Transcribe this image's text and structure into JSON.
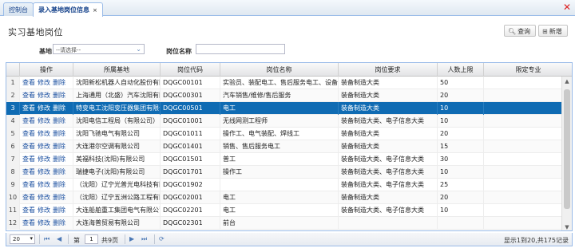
{
  "tabs": [
    {
      "label": "控制台"
    },
    {
      "label": "录入基地岗位信息",
      "close": "×"
    }
  ],
  "window_close_icon": "close-icon",
  "page": {
    "title": "实习基地岗位"
  },
  "toolbar": {
    "search_label": "查询",
    "add_label": "新增"
  },
  "filters": {
    "base_label": "基地",
    "base_value": "--请选择--",
    "post_label": "岗位名称",
    "post_value": ""
  },
  "grid": {
    "columns": [
      "",
      "操作",
      "所属基地",
      "岗位代码",
      "岗位名称",
      "岗位要求",
      "人数上限",
      "限定专业"
    ],
    "ops": {
      "view": "查看",
      "edit": "修改",
      "delete": "删除"
    },
    "rows": [
      {
        "no": "1",
        "base": "沈阳新松机器人自动化股份有限公",
        "code": "DQGC00101",
        "name": "实验员、装配电工、售后服务电工、设备调试",
        "req": "装备制造大类",
        "limit": "50",
        "major": ""
      },
      {
        "no": "2",
        "base": "上海通用（北盛）汽车沈阳有限公",
        "code": "DQGC00301",
        "name": "汽车销售/维修/售后服务",
        "req": "装备制造大类",
        "limit": "20",
        "major": ""
      },
      {
        "no": "3",
        "base": "特变电工沈阳变压器集团有限公司",
        "code": "DQGC00501",
        "name": "电工",
        "req": "装备制造大类",
        "limit": "10",
        "major": ""
      },
      {
        "no": "4",
        "base": "沈阳电信工程局（有限公司）",
        "code": "DQGC01001",
        "name": "无线网测工程师",
        "req": "装备制造大类、电子信息大类",
        "limit": "10",
        "major": ""
      },
      {
        "no": "5",
        "base": "沈阳飞驰电气有限公司",
        "code": "DQGC01011",
        "name": "操作工、电气装配、焊线工",
        "req": "装备制造大类",
        "limit": "20",
        "major": ""
      },
      {
        "no": "6",
        "base": "大连港尔空调有限公司",
        "code": "DQGC01401",
        "name": "销售、售后服务电工",
        "req": "装备制造大类",
        "limit": "15",
        "major": ""
      },
      {
        "no": "7",
        "base": "美福科技(沈阳)有限公司",
        "code": "DQGC01501",
        "name": "普工",
        "req": "装备制造大类、电子信息大类",
        "limit": "30",
        "major": ""
      },
      {
        "no": "8",
        "base": "瑞捷电子(沈阳)有限公司",
        "code": "DQGC01701",
        "name": "操作工",
        "req": "装备制造大类、电子信息大类",
        "limit": "10",
        "major": ""
      },
      {
        "no": "9",
        "base": "（沈阳）辽宁光普光电科技有限公",
        "code": "DQGC01902",
        "name": "",
        "req": "装备制造大类、电子信息大类",
        "limit": "25",
        "major": ""
      },
      {
        "no": "10",
        "base": "（沈阳）辽宁五洲公路工程有限公",
        "code": "DQGC02001",
        "name": "电工",
        "req": "装备制造大类",
        "limit": "20",
        "major": ""
      },
      {
        "no": "11",
        "base": "大连船舶重工集团电气有限公司",
        "code": "DQGC02201",
        "name": "电工",
        "req": "装备制造大类、电子信息大类",
        "limit": "10",
        "major": ""
      },
      {
        "no": "12",
        "base": "大连海普贸易有限公司",
        "code": "DQGC02301",
        "name": "前台",
        "req": "",
        "limit": "",
        "major": ""
      }
    ]
  },
  "pager": {
    "page_size": "20",
    "page_prefix": "第",
    "page_current": "1",
    "page_suffix": "共9页",
    "info": "显示1到20,共175记录"
  }
}
